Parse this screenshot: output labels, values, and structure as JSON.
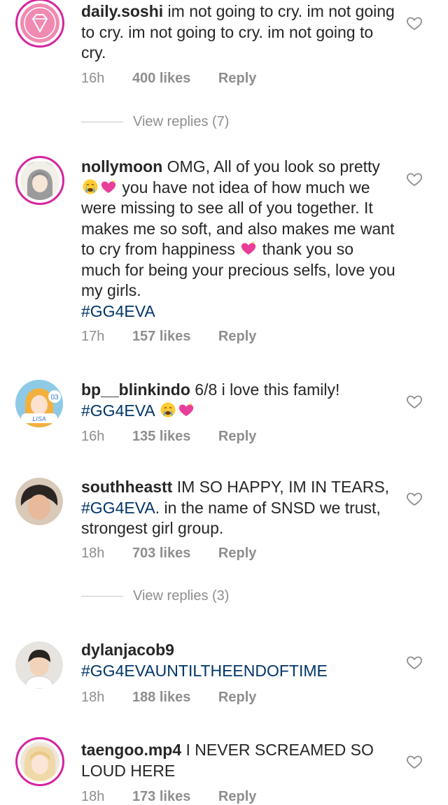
{
  "comments": [
    {
      "username": "daily.soshi",
      "text": " im not going to cry. im not going to cry. im not going to cry. im not going to cry.",
      "time": "16h",
      "likes": "400 likes",
      "reply": "Reply",
      "view_replies": "View replies (7)"
    },
    {
      "username": "nollymoon",
      "text_1": " OMG, All of you look so pretty ",
      "text_2": " you have not idea of how much we were missing to see all of you together. It makes me so soft, and also makes me want to cry from happiness ",
      "text_3": " thank you so much for being your precious selfs, love you my girls.",
      "hashtag": "#GG4EVA",
      "time": "17h",
      "likes": "157 likes",
      "reply": "Reply"
    },
    {
      "username": "bp__blinkindo",
      "text": " 6/8 i love this family!",
      "hashtag": "#GG4EVA",
      "avatar_label": "LISA",
      "avatar_number": "03",
      "time": "16h",
      "likes": "135 likes",
      "reply": "Reply"
    },
    {
      "username": "southheastt",
      "text_1": " IM SO HAPPY, IM IN TEARS, ",
      "hashtag": "#GG4EVA",
      "text_2": ". in the name of SNSD we trust, strongest girl group.",
      "time": "18h",
      "likes": "703 likes",
      "reply": "Reply",
      "view_replies": "View replies (3)"
    },
    {
      "username": "dylanjacob9",
      "hashtag": "#GG4EVAUNTILTHEENDOFTIME",
      "time": "18h",
      "likes": "188 likes",
      "reply": "Reply"
    },
    {
      "username": "taengoo.mp4",
      "text": " I NEVER SCREAMED SO LOUD HERE",
      "time": "18h",
      "likes": "173 likes",
      "reply": "Reply"
    }
  ],
  "icons": {
    "heart": "heart-outline-icon",
    "crying": "crying-face-emoji",
    "sparkling_heart": "sparkling-heart-emoji"
  },
  "colors": {
    "username": "#262626",
    "hashtag": "#003569",
    "meta": "#8e8e8e",
    "story_ring": "#d6249f"
  }
}
